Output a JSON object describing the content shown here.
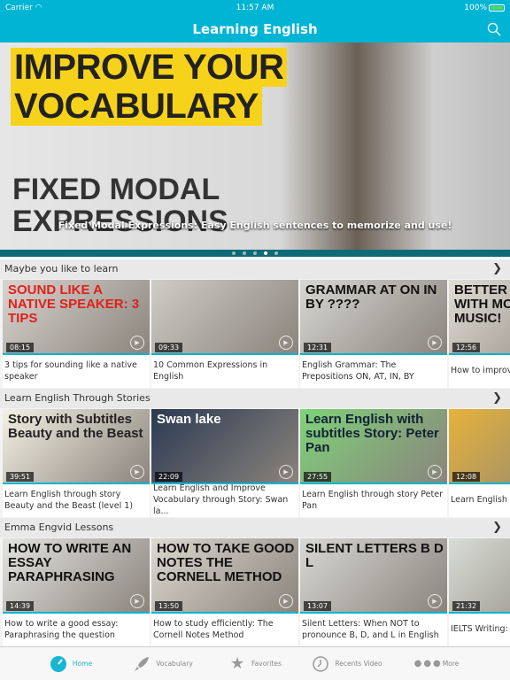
{
  "status": {
    "carrier": "Carrier",
    "time": "11:57 AM",
    "battery": "100%"
  },
  "nav": {
    "title": "Learning English",
    "search_icon": "search-icon"
  },
  "banner": {
    "thumb_line1": "IMPROVE YOUR",
    "thumb_line2": "VOCABULARY",
    "thumb_line3": "FIXED MODAL",
    "thumb_line4": "EXPRESSIONS",
    "caption": "Fixed Modal Expressions: Easy English sentences to memorize and use!",
    "pages": 5,
    "active_page": 4
  },
  "sections": [
    {
      "title": "Maybe you like to learn",
      "cards": [
        {
          "thumb": "SOUND LIKE A NATIVE SPEAKER: 3 TIPS",
          "duration": "08:15",
          "title": "3 tips for sounding like a native speaker",
          "bg": "#d9d4cf",
          "fg": "#e0201c"
        },
        {
          "thumb": "",
          "duration": "09:33",
          "title": "10 Common Expressions in English",
          "bg": "#cfccc6",
          "fg": "#333"
        },
        {
          "thumb": "GRAMMAR AT ON IN BY ????",
          "duration": "12:31",
          "title": "English Grammar: The Prepositions ON, AT, IN, BY",
          "bg": "#d7d7d2",
          "fg": "#111"
        },
        {
          "thumb": "BETTER ENGLISH WITH MOVIES AND MUSIC!",
          "duration": "12:56",
          "title": "How to improve MUSIC and MO",
          "bg": "#e2ddd5",
          "fg": "#111"
        }
      ]
    },
    {
      "title": "Learn English Through Stories",
      "cards": [
        {
          "thumb": "Story with Subtitles Beauty and the Beast",
          "duration": "39:51",
          "title": "Learn English through story Beauty and the Beast (level 1)",
          "bg": "#f4f0e4",
          "fg": "#222"
        },
        {
          "thumb": "Swan lake",
          "duration": "22:09",
          "title": "Learn English and Improve Vocabulary through Story: Swan la...",
          "bg": "#2b3a52",
          "fg": "#fff"
        },
        {
          "thumb": "Learn English with subtitles Story: Peter Pan",
          "duration": "27:55",
          "title": "Learn English through story Peter Pan",
          "bg": "#7fd27a",
          "fg": "#123"
        },
        {
          "thumb": "",
          "duration": "12:08",
          "title": "Learn English th and the Forty Th",
          "bg": "#e6b23a",
          "fg": "#222"
        }
      ]
    },
    {
      "title": "Emma Engvid Lessons",
      "cards": [
        {
          "thumb": "HOW TO WRITE AN ESSAY PARAPHRASING",
          "duration": "14:39",
          "title": "How to write a good essay: Paraphrasing the question",
          "bg": "#e4e4e0",
          "fg": "#111"
        },
        {
          "thumb": "HOW TO TAKE GOOD NOTES THE CORNELL METHOD",
          "duration": "13:50",
          "title": "How to study efficiently: The Cornell Notes Method",
          "bg": "#ddd8cf",
          "fg": "#111"
        },
        {
          "thumb": "SILENT LETTERS B D L",
          "duration": "13:07",
          "title": "Silent Letters: When NOT to pronounce B, D, and L in English",
          "bg": "#d8d8d4",
          "fg": "#111"
        },
        {
          "thumb": "",
          "duration": "21:32",
          "title": "IELTS Writing: N Pie Charts",
          "bg": "#d9ddd5",
          "fg": "#111"
        }
      ]
    }
  ],
  "tabs": [
    {
      "label": "Home",
      "icon": "speedometer-icon",
      "active": true
    },
    {
      "label": "Vocabulary",
      "icon": "rocket-icon",
      "active": false
    },
    {
      "label": "Favorites",
      "icon": "star-icon",
      "active": false
    },
    {
      "label": "Recents Video",
      "icon": "clock-icon",
      "active": false
    },
    {
      "label": "More",
      "icon": "more-dots-icon",
      "active": false
    }
  ],
  "colors": {
    "accent": "#00b4d4"
  }
}
